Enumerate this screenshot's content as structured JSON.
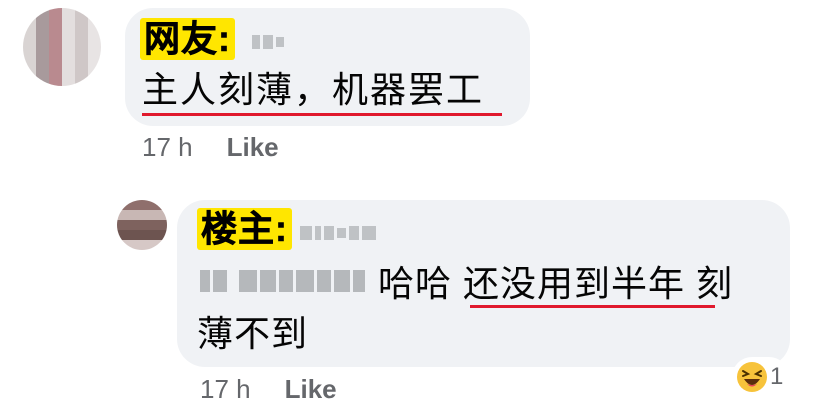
{
  "comments": [
    {
      "role_tag": "网友:",
      "text": "主人刻薄，机器罢工",
      "time": "17 h",
      "like_label": "Like"
    },
    {
      "role_tag": "楼主:",
      "text_line1": "哈哈 还没用到半年 刻",
      "text_line2": "薄不到",
      "time": "17 h",
      "like_label": "Like",
      "reaction": {
        "icon": "laughing-emoji-icon",
        "count": "1"
      }
    }
  ],
  "colors": {
    "bubble_bg": "#f0f2f5",
    "tag_highlight": "#ffe600",
    "underline": "#e0192d",
    "meta_text": "#65676b"
  }
}
